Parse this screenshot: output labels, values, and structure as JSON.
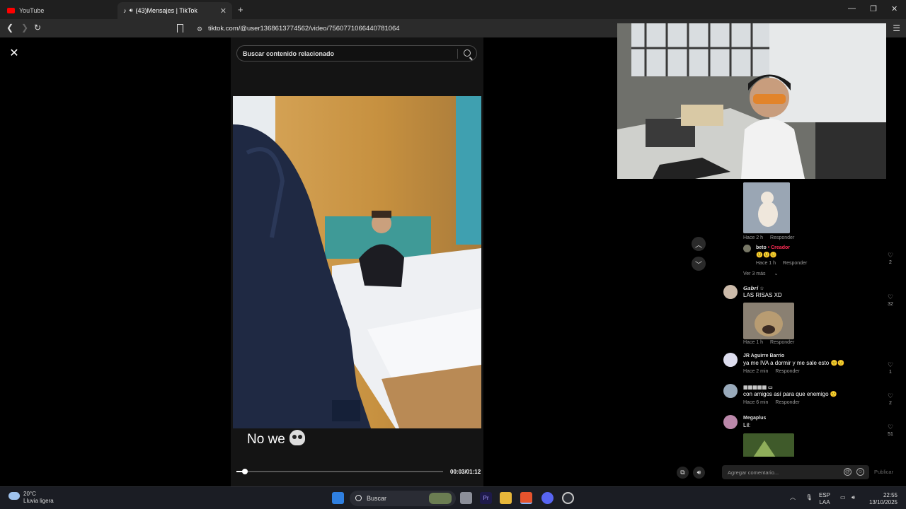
{
  "browser": {
    "tabs": [
      {
        "title": "YouTube",
        "active": false
      },
      {
        "title": "(43)Mensajes | TikTok",
        "active": true
      }
    ],
    "url": "tiktok.com/@user1368613774562/video/7560771066440781064"
  },
  "video": {
    "search_placeholder": "Buscar contenido relacionado",
    "caption": "No we",
    "time": "00:03/01:12",
    "progress_fraction": 0.042
  },
  "comments": {
    "items": [
      {
        "meta": [
          "Hace 2 h",
          "Responder"
        ]
      },
      {
        "user": "beto",
        "badge": "• Creador",
        "meta": [
          "Hace 1 h",
          "Responder"
        ],
        "likes": "2"
      },
      {
        "more": "Ver 3 más"
      },
      {
        "user": "𝙂𝙖𝙗𝙧𝙞 ☆",
        "text": "LAS RISAS XD",
        "meta": [
          "Hace 1 h",
          "Responder"
        ],
        "likes": "32"
      },
      {
        "user": "JR Aguirre Barrio",
        "text": "ya me IVA a dormir y me sale esto",
        "meta": [
          "Hace 2 min",
          "Responder"
        ],
        "likes": "1"
      },
      {
        "user": "▦▦▦▦▦ ▭",
        "text": "con amigos así para que enemigo",
        "meta": [
          "Hace 6 min",
          "Responder"
        ],
        "likes": "2"
      },
      {
        "user": "Megaplus",
        "text": "Lil:",
        "likes": "51"
      }
    ],
    "input_placeholder": "Agregar comentario...",
    "publish_label": "Publicar"
  },
  "taskbar": {
    "temp": "20°C",
    "weather": "Lluvia ligera",
    "search_label": "Buscar",
    "lang": "ESP",
    "lang_sub": "LAA",
    "time": "22:55",
    "date": "13/10/2025"
  }
}
